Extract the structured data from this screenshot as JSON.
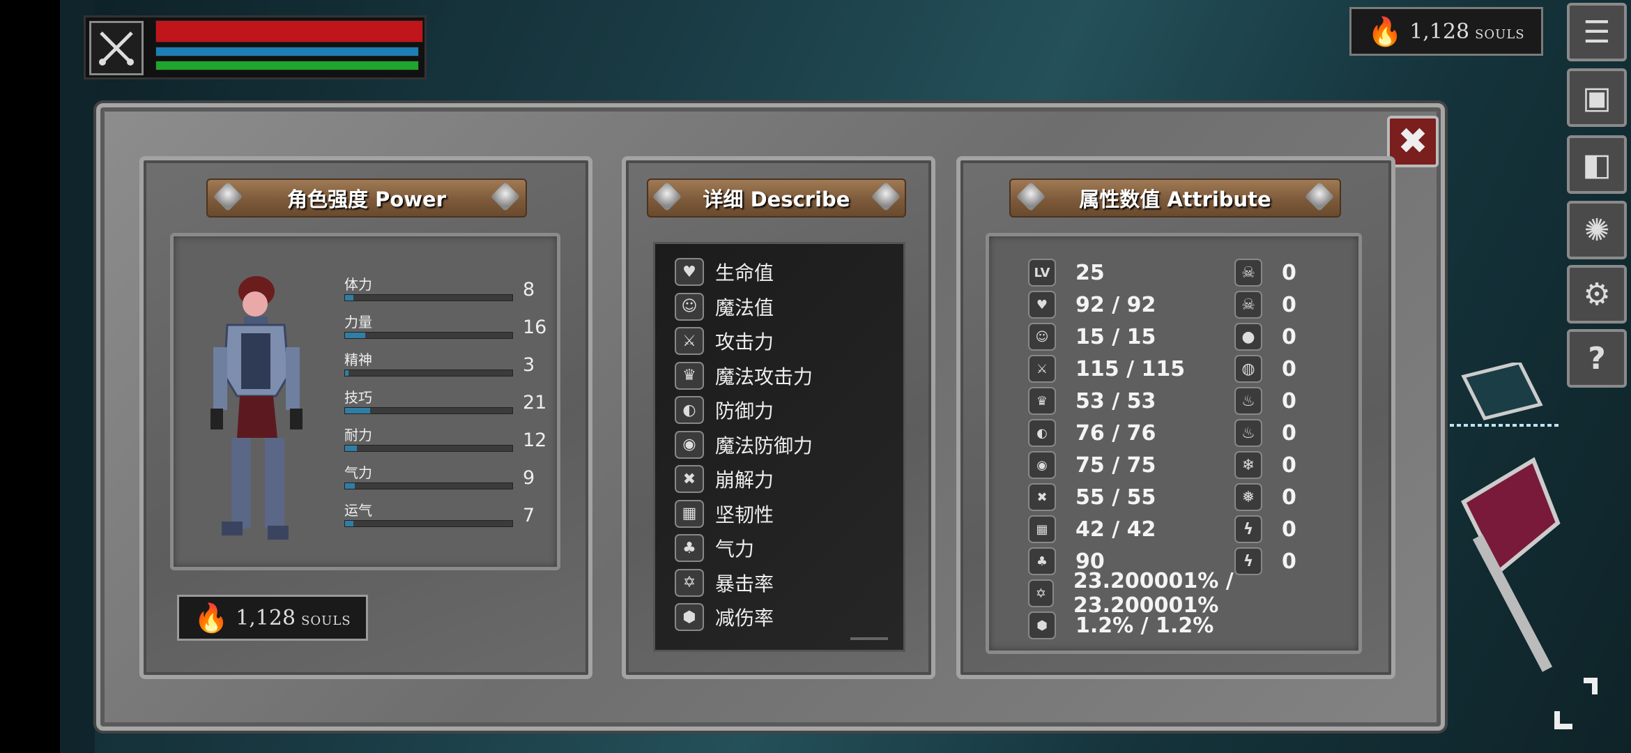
{
  "souls": {
    "amount": "1,128",
    "unit": "SOULS"
  },
  "panels": {
    "power_title": "角色强度 Power",
    "describe_title": "详细 Describe",
    "attribute_title": "属性数值 Attribute"
  },
  "stats": [
    {
      "label": "体力",
      "value": "8",
      "fill": 0.05
    },
    {
      "label": "力量",
      "value": "16",
      "fill": 0.12
    },
    {
      "label": "精神",
      "value": "3",
      "fill": 0.02
    },
    {
      "label": "技巧",
      "value": "21",
      "fill": 0.15
    },
    {
      "label": "耐力",
      "value": "12",
      "fill": 0.07
    },
    {
      "label": "气力",
      "value": "9",
      "fill": 0.06
    },
    {
      "label": "运气",
      "value": "7",
      "fill": 0.05
    }
  ],
  "describe": [
    {
      "label": "生命值",
      "icon": "heart-icon",
      "glyph": "♥"
    },
    {
      "label": "魔法值",
      "icon": "head-icon",
      "glyph": "☺"
    },
    {
      "label": "攻击力",
      "icon": "sword-icon",
      "glyph": "⚔"
    },
    {
      "label": "魔法攻击力",
      "icon": "magic-attack-icon",
      "glyph": "♛"
    },
    {
      "label": "防御力",
      "icon": "shield-icon",
      "glyph": "◐"
    },
    {
      "label": "魔法防御力",
      "icon": "magic-shield-icon",
      "glyph": "◉"
    },
    {
      "label": "崩解力",
      "icon": "break-icon",
      "glyph": "✖"
    },
    {
      "label": "坚韧性",
      "icon": "helmet-icon",
      "glyph": "▦"
    },
    {
      "label": "气力",
      "icon": "lungs-icon",
      "glyph": "♣"
    },
    {
      "label": "暴击率",
      "icon": "critical-icon",
      "glyph": "✡"
    },
    {
      "label": "减伤率",
      "icon": "damage-reduction-icon",
      "glyph": "⬢"
    }
  ],
  "attributes_left": [
    {
      "icon": "level-icon",
      "glyph": "LV",
      "value": "25"
    },
    {
      "icon": "heart-icon",
      "glyph": "♥",
      "value": "92 / 92"
    },
    {
      "icon": "head-icon",
      "glyph": "☺",
      "value": "15 / 15"
    },
    {
      "icon": "sword-icon",
      "glyph": "⚔",
      "value": "115 / 115"
    },
    {
      "icon": "magic-attack-icon",
      "glyph": "♛",
      "value": "53 / 53"
    },
    {
      "icon": "shield-icon",
      "glyph": "◐",
      "value": "76 / 76"
    },
    {
      "icon": "magic-shield-icon",
      "glyph": "◉",
      "value": "75 / 75"
    },
    {
      "icon": "break-icon",
      "glyph": "✖",
      "value": "55 / 55"
    },
    {
      "icon": "helmet-icon",
      "glyph": "▦",
      "value": "42 / 42"
    },
    {
      "icon": "lungs-icon",
      "glyph": "♣",
      "value": "90"
    },
    {
      "icon": "critical-icon",
      "glyph": "✡",
      "value": "23.200001% / 23.200001%"
    },
    {
      "icon": "damage-reduction-icon",
      "glyph": "⬢",
      "value": "1.2% / 1.2%"
    }
  ],
  "attributes_right": [
    {
      "icon": "poison-skull-icon",
      "glyph": "☠",
      "value": "0"
    },
    {
      "icon": "poison-resist-icon",
      "glyph": "☠",
      "value": "0"
    },
    {
      "icon": "bleed-icon",
      "glyph": "●",
      "value": "0"
    },
    {
      "icon": "bleed-resist-icon",
      "glyph": "◍",
      "value": "0"
    },
    {
      "icon": "fire-icon",
      "glyph": "♨",
      "value": "0"
    },
    {
      "icon": "fire-resist-icon",
      "glyph": "♨",
      "value": "0"
    },
    {
      "icon": "frost-icon",
      "glyph": "❄",
      "value": "0"
    },
    {
      "icon": "frost-resist-icon",
      "glyph": "❅",
      "value": "0"
    },
    {
      "icon": "lightning-icon",
      "glyph": "ϟ",
      "value": "0"
    },
    {
      "icon": "lightning-resist-icon",
      "glyph": "ϟ",
      "value": "0"
    }
  ],
  "hud": {
    "health": 1.0,
    "mana": 1.0,
    "stamina": 1.0
  },
  "colors": {
    "health": "#c0151a",
    "mana": "#1e7fb5",
    "stamina": "#1fa52e",
    "close": "#7a1e1e"
  }
}
